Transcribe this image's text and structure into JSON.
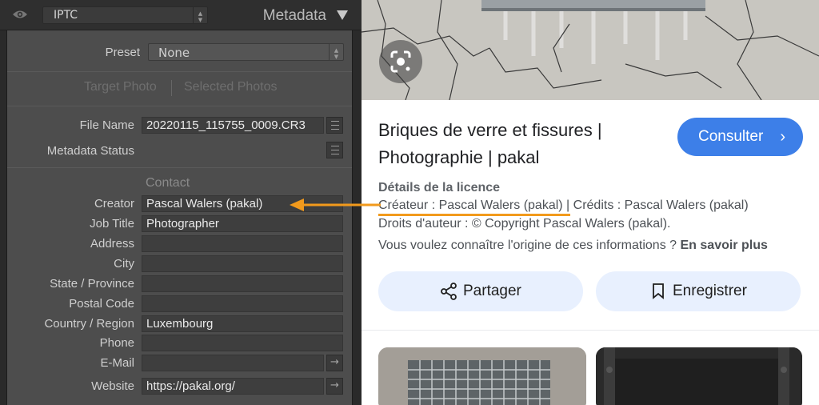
{
  "lightroom": {
    "top": {
      "set_value": "IPTC",
      "title": "Metadata"
    },
    "preset": {
      "label": "Preset",
      "value": "None"
    },
    "target": {
      "target_photo": "Target Photo",
      "selected_photos": "Selected Photos"
    },
    "file_name": {
      "label": "File Name",
      "value": "20220115_115755_0009.CR3"
    },
    "metadata_status": {
      "label": "Metadata Status"
    },
    "contact_section": "Contact",
    "fields": [
      {
        "label": "Creator",
        "value": "Pascal Walers (pakal)"
      },
      {
        "label": "Job Title",
        "value": "Photographer"
      },
      {
        "label": "Address",
        "value": ""
      },
      {
        "label": "City",
        "value": ""
      },
      {
        "label": "State / Province",
        "value": ""
      },
      {
        "label": "Postal Code",
        "value": ""
      },
      {
        "label": "Country / Region",
        "value": "Luxembourg"
      },
      {
        "label": "Phone",
        "value": ""
      },
      {
        "label": "E-Mail",
        "value": ""
      },
      {
        "label": "Website",
        "value": "https://pakal.org/"
      }
    ]
  },
  "google": {
    "title_line1": "Briques de verre et fissures |",
    "title_line2": "Photographie | pakal",
    "visit_label": "Consulter",
    "license_heading": "Détails de la licence",
    "creator_text": "Créateur : Pascal Walers (pakal)",
    "credits_text": " | Crédits : Pascal Walers (pakal)",
    "copyright_text": "Droits d'auteur : © Copyright Pascal Walers (pakal).",
    "origin_question": "Vous voulez connaître l'origine de ces informations ? ",
    "learn_more": "En savoir plus",
    "share_label": "Partager",
    "save_label": "Enregistrer"
  },
  "colors": {
    "accent_orange": "#f29a1c",
    "google_blue": "#3d7fe8",
    "pill_bg": "#e8f0fe"
  },
  "icons": [
    "eye-icon",
    "google-lens-icon",
    "share-icon",
    "bookmark-icon",
    "chevron-right-icon",
    "list-icon",
    "arrow-right-icon"
  ]
}
